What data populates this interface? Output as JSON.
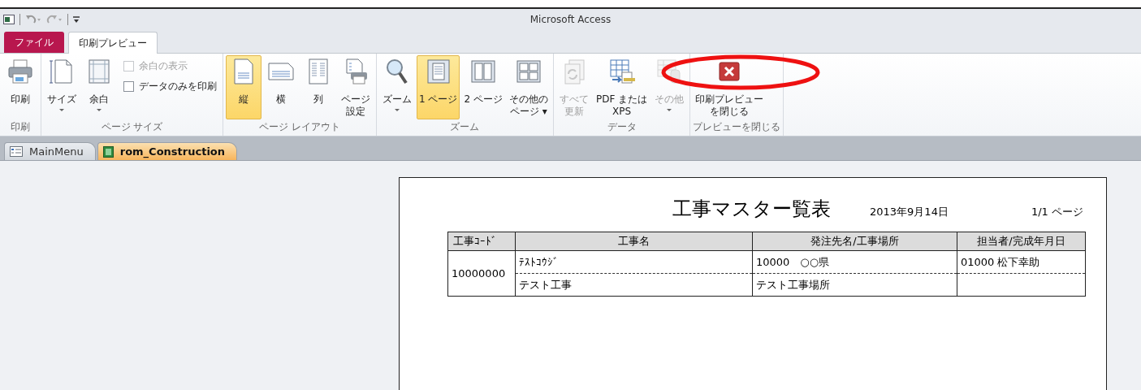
{
  "window": {
    "title": "Microsoft Access"
  },
  "ribbon_tabs": [
    {
      "label": "ファイル",
      "kind": "file",
      "selected": false
    },
    {
      "label": "印刷プレビュー",
      "kind": "tab",
      "selected": true
    }
  ],
  "ribbon_groups": [
    {
      "label": "印刷",
      "items": [
        {
          "kind": "large",
          "lines": [
            "印刷"
          ],
          "disabled": false,
          "selected": false,
          "dropdown": false
        }
      ]
    },
    {
      "label": "ページ サイズ",
      "items": [
        {
          "kind": "large",
          "lines": [
            "サイズ"
          ],
          "disabled": false,
          "selected": false,
          "dropdown": true
        },
        {
          "kind": "large",
          "lines": [
            "余白"
          ],
          "disabled": false,
          "selected": false,
          "dropdown": true
        },
        {
          "kind": "checks",
          "checks": [
            {
              "label": "余白の表示",
              "checked": false,
              "disabled": true
            },
            {
              "label": "データのみを印刷",
              "checked": false,
              "disabled": false
            }
          ]
        }
      ]
    },
    {
      "label": "ページ レイアウト",
      "items": [
        {
          "kind": "large",
          "lines": [
            "縦"
          ],
          "disabled": false,
          "selected": true,
          "dropdown": false
        },
        {
          "kind": "large",
          "lines": [
            "横"
          ],
          "disabled": false,
          "selected": false,
          "dropdown": false
        },
        {
          "kind": "large",
          "lines": [
            "列"
          ],
          "disabled": false,
          "selected": false,
          "dropdown": false
        },
        {
          "kind": "large",
          "lines": [
            "ページ",
            "設定"
          ],
          "disabled": false,
          "selected": false,
          "dropdown": false
        }
      ]
    },
    {
      "label": "ズーム",
      "items": [
        {
          "kind": "large",
          "lines": [
            "ズーム"
          ],
          "disabled": false,
          "selected": false,
          "dropdown": true
        },
        {
          "kind": "large",
          "lines": [
            "1 ページ"
          ],
          "disabled": false,
          "selected": true,
          "dropdown": false
        },
        {
          "kind": "large",
          "lines": [
            "2 ページ"
          ],
          "disabled": false,
          "selected": false,
          "dropdown": false
        },
        {
          "kind": "large",
          "lines": [
            "その他の",
            "ページ ▾"
          ],
          "disabled": false,
          "selected": false,
          "dropdown": false
        }
      ]
    },
    {
      "label": "データ",
      "items": [
        {
          "kind": "large",
          "lines": [
            "すべて",
            "更新"
          ],
          "disabled": true,
          "selected": false,
          "dropdown": false
        },
        {
          "kind": "large",
          "lines": [
            "PDF または",
            "XPS"
          ],
          "disabled": false,
          "selected": false,
          "dropdown": false
        },
        {
          "kind": "large",
          "lines": [
            "その他"
          ],
          "disabled": true,
          "selected": false,
          "dropdown": true
        }
      ]
    },
    {
      "label": "プレビューを閉じる",
      "items": [
        {
          "kind": "large",
          "lines": [
            "印刷プレビュー",
            "を閉じる"
          ],
          "disabled": false,
          "selected": false,
          "dropdown": false
        }
      ]
    }
  ],
  "annotation": {
    "kind": "ellipse"
  },
  "document_tabs": [
    {
      "label": "MainMenu",
      "kind": "form",
      "selected": false
    },
    {
      "label": "rom_Construction",
      "kind": "report",
      "selected": true
    }
  ],
  "report": {
    "title": "工事マスター覧表",
    "date": "2013年9月14日",
    "page": "1/1 ページ",
    "columns": [
      "工事ｺｰﾄﾞ",
      "工事名",
      "発注先名/工事場所",
      "担当者/完成年月日"
    ],
    "records": [
      {
        "code": "10000000",
        "lines": [
          [
            "ﾃｽﾄｺｳｼﾞ",
            "10000　○○県",
            "01000 松下幸助"
          ],
          [
            "テスト工事",
            "テスト工事場所"
          ]
        ]
      }
    ]
  }
}
